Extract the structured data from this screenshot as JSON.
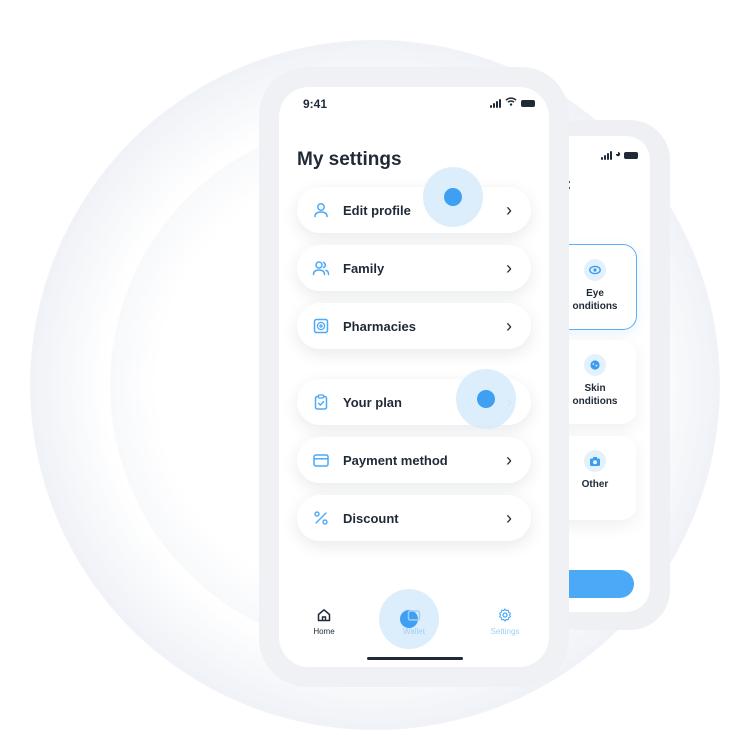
{
  "status_bar": {
    "time": "9:41"
  },
  "settings": {
    "title": "My settings",
    "items": [
      {
        "label": "Edit profile",
        "icon": "user-icon"
      },
      {
        "label": "Family",
        "icon": "users-icon"
      },
      {
        "label": "Pharmacies",
        "icon": "medical-cross-icon"
      },
      {
        "label": "Your plan",
        "icon": "clipboard-icon"
      },
      {
        "label": "Payment method",
        "icon": "credit-card-icon"
      },
      {
        "label": "Discount",
        "icon": "percent-icon"
      }
    ]
  },
  "tabbar": {
    "home": "Home",
    "wallet": "Wallet",
    "settings": "Settings"
  },
  "back_screen": {
    "title_fragment": ":",
    "categories": [
      {
        "line1": "Eye",
        "line2": "onditions",
        "icon": "eye-icon",
        "selected": true
      },
      {
        "line1": "Skin",
        "line2": "onditions",
        "icon": "skin-icon",
        "selected": false
      },
      {
        "line1": "Other",
        "line2": "",
        "icon": "camera-icon",
        "selected": false
      }
    ]
  },
  "colors": {
    "accent": "#4BA9F7",
    "text": "#1F2A37",
    "touch_highlight": "#D6EBFC",
    "frame": "#EFF1F4"
  }
}
